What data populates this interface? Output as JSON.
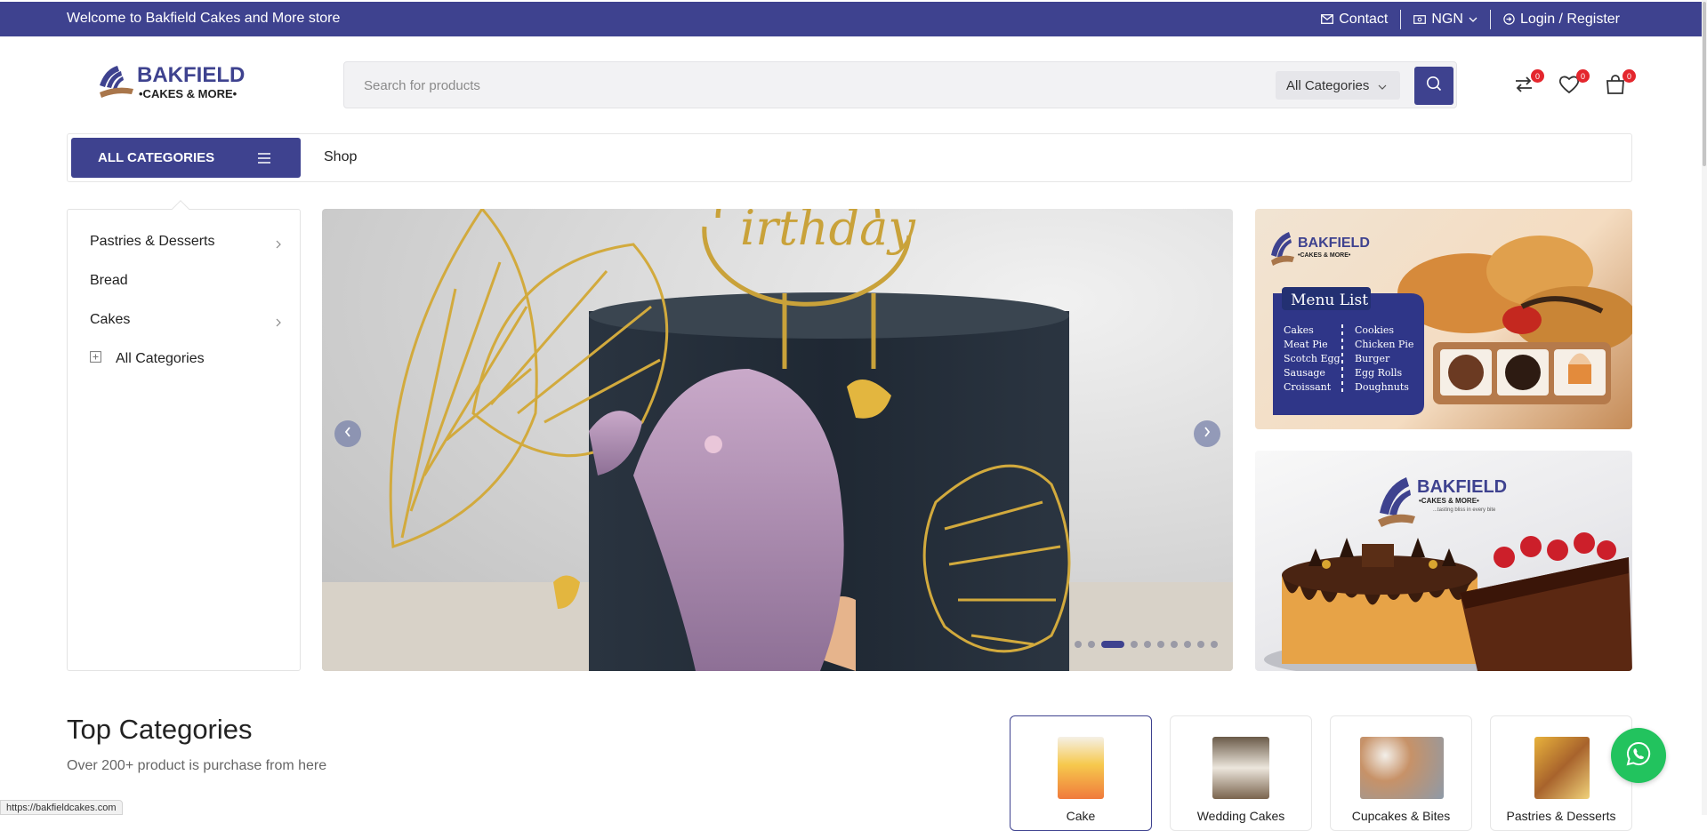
{
  "topbar": {
    "welcome": "Welcome to Bakfield Cakes and More store",
    "contact": "Contact",
    "currency": "NGN",
    "login": "Login / Register"
  },
  "header": {
    "logo_text_main": "BAKFIELD",
    "logo_text_sub": "•CAKES & MORE•",
    "search_placeholder": "Search for products",
    "category_selected": "All Categories",
    "compare_count": "0",
    "wishlist_count": "0",
    "cart_count": "0"
  },
  "nav": {
    "all_categories": "ALL CATEGORIES",
    "links": [
      "Shop"
    ]
  },
  "sidebar": {
    "items": [
      {
        "label": "Pastries & Desserts",
        "has_children": true
      },
      {
        "label": "Bread",
        "has_children": false
      },
      {
        "label": "Cakes",
        "has_children": true
      },
      {
        "label": "All Categories",
        "has_children": false
      }
    ]
  },
  "slider": {
    "topper_text": "irthday",
    "slide_count": 10,
    "active_slide": 3
  },
  "banners": {
    "banner1": {
      "brand": "BAKFIELD",
      "brand_sub": "•CAKES & MORE•",
      "menu_title": "Menu List",
      "menu_col1": [
        "Cakes",
        "Meat Pie",
        "Scotch Egg",
        "Sausage",
        "Croissant"
      ],
      "menu_col2": [
        "Cookies",
        "Chicken Pie",
        "Burger",
        "Egg Rolls",
        "Doughnuts"
      ]
    },
    "banner2": {
      "brand": "BAKFIELD",
      "brand_sub": "•CAKES & MORE•",
      "tagline": "...tasting bliss in every bite"
    }
  },
  "top_categories": {
    "title": "Top Categories",
    "subtitle": "Over 200+ product is purchase from here",
    "cards": [
      {
        "label": "Cake"
      },
      {
        "label": "Wedding Cakes"
      },
      {
        "label": "Cupcakes & Bites"
      },
      {
        "label": "Pastries & Desserts"
      }
    ]
  },
  "status_bar": {
    "url": "https://bakfieldcakes.com"
  },
  "colors": {
    "brand": "#3e428f",
    "badge": "#e4262d",
    "whatsapp": "#22c35e"
  }
}
